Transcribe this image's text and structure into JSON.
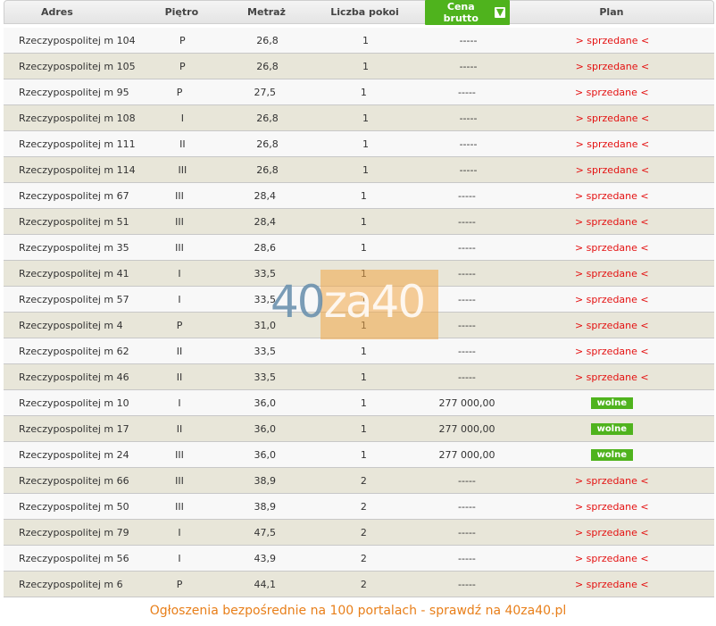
{
  "header": {
    "adres": "Adres",
    "pietro": "Piętro",
    "metraz": "Metraż",
    "pokoi": "Liczba pokoi",
    "cena": "Cena brutto",
    "plan": "Plan"
  },
  "sort_icon": "arrow-down-icon",
  "rows": [
    {
      "adres": "Rzeczypospolitej m 104",
      "pietro": "P",
      "metraz": "26,8",
      "pokoi": "1",
      "cena": "-----",
      "plan": "> sprzedane <",
      "status": "sold"
    },
    {
      "adres": "Rzeczypospolitej m 105",
      "pietro": "P",
      "metraz": "26,8",
      "pokoi": "1",
      "cena": "-----",
      "plan": "> sprzedane <",
      "status": "sold"
    },
    {
      "adres": "Rzeczypospolitej m 95",
      "pietro": "P",
      "metraz": "27,5",
      "pokoi": "1",
      "cena": "-----",
      "plan": "> sprzedane <",
      "status": "sold"
    },
    {
      "adres": "Rzeczypospolitej m 108",
      "pietro": "I",
      "metraz": "26,8",
      "pokoi": "1",
      "cena": "-----",
      "plan": "> sprzedane <",
      "status": "sold"
    },
    {
      "adres": "Rzeczypospolitej m 111",
      "pietro": "II",
      "metraz": "26,8",
      "pokoi": "1",
      "cena": "-----",
      "plan": "> sprzedane <",
      "status": "sold"
    },
    {
      "adres": "Rzeczypospolitej m 114",
      "pietro": "III",
      "metraz": "26,8",
      "pokoi": "1",
      "cena": "-----",
      "plan": "> sprzedane <",
      "status": "sold"
    },
    {
      "adres": "Rzeczypospolitej m 67",
      "pietro": "III",
      "metraz": "28,4",
      "pokoi": "1",
      "cena": "-----",
      "plan": "> sprzedane <",
      "status": "sold"
    },
    {
      "adres": "Rzeczypospolitej m 51",
      "pietro": "III",
      "metraz": "28,4",
      "pokoi": "1",
      "cena": "-----",
      "plan": "> sprzedane <",
      "status": "sold"
    },
    {
      "adres": "Rzeczypospolitej m 35",
      "pietro": "III",
      "metraz": "28,6",
      "pokoi": "1",
      "cena": "-----",
      "plan": "> sprzedane <",
      "status": "sold"
    },
    {
      "adres": "Rzeczypospolitej m 41",
      "pietro": "I",
      "metraz": "33,5",
      "pokoi": "1",
      "cena": "-----",
      "plan": "> sprzedane <",
      "status": "sold"
    },
    {
      "adres": "Rzeczypospolitej m 57",
      "pietro": "I",
      "metraz": "33,5",
      "pokoi": "1",
      "cena": "-----",
      "plan": "> sprzedane <",
      "status": "sold"
    },
    {
      "adres": "Rzeczypospolitej m 4",
      "pietro": "P",
      "metraz": "31,0",
      "pokoi": "1",
      "cena": "-----",
      "plan": "> sprzedane <",
      "status": "sold"
    },
    {
      "adres": "Rzeczypospolitej m 62",
      "pietro": "II",
      "metraz": "33,5",
      "pokoi": "1",
      "cena": "-----",
      "plan": "> sprzedane <",
      "status": "sold"
    },
    {
      "adres": "Rzeczypospolitej m 46",
      "pietro": "II",
      "metraz": "33,5",
      "pokoi": "1",
      "cena": "-----",
      "plan": "> sprzedane <",
      "status": "sold"
    },
    {
      "adres": "Rzeczypospolitej m 10",
      "pietro": "I",
      "metraz": "36,0",
      "pokoi": "1",
      "cena": "277 000,00",
      "plan": "wolne",
      "status": "free"
    },
    {
      "adres": "Rzeczypospolitej m 17",
      "pietro": "II",
      "metraz": "36,0",
      "pokoi": "1",
      "cena": "277 000,00",
      "plan": "wolne",
      "status": "free"
    },
    {
      "adres": "Rzeczypospolitej m 24",
      "pietro": "III",
      "metraz": "36,0",
      "pokoi": "1",
      "cena": "277 000,00",
      "plan": "wolne",
      "status": "free"
    },
    {
      "adres": "Rzeczypospolitej m 66",
      "pietro": "III",
      "metraz": "38,9",
      "pokoi": "2",
      "cena": "-----",
      "plan": "> sprzedane <",
      "status": "sold"
    },
    {
      "adres": "Rzeczypospolitej m 50",
      "pietro": "III",
      "metraz": "38,9",
      "pokoi": "2",
      "cena": "-----",
      "plan": "> sprzedane <",
      "status": "sold"
    },
    {
      "adres": "Rzeczypospolitej m 79",
      "pietro": "I",
      "metraz": "47,5",
      "pokoi": "2",
      "cena": "-----",
      "plan": "> sprzedane <",
      "status": "sold"
    },
    {
      "adres": "Rzeczypospolitej m 56",
      "pietro": "I",
      "metraz": "43,9",
      "pokoi": "2",
      "cena": "-----",
      "plan": "> sprzedane <",
      "status": "sold"
    },
    {
      "adres": "Rzeczypospolitej m 6",
      "pietro": "P",
      "metraz": "44,1",
      "pokoi": "2",
      "cena": "-----",
      "plan": "> sprzedane <",
      "status": "sold"
    }
  ],
  "watermark": {
    "text_a": "40",
    "text_b": "za",
    "text_c": "40"
  },
  "footer": "Ogłoszenia bezpośrednie na 100 portalach - sprawdź na 40za40.pl",
  "colors": {
    "accent_green": "#4fb31d",
    "sold_red": "#e41111",
    "footer_orange": "#e87f1a",
    "row_alt": "#e8e6d9"
  }
}
